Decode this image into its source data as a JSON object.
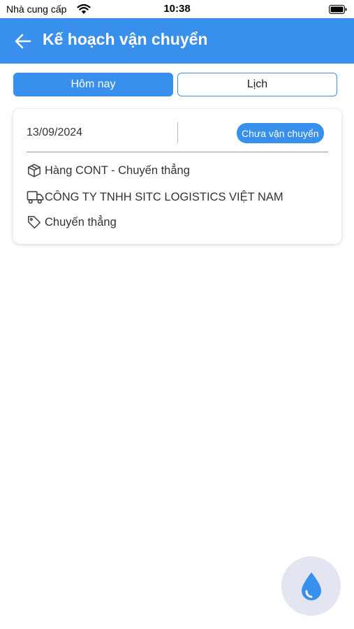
{
  "status_bar": {
    "carrier": "Nhà cung cấp",
    "time": "10:38"
  },
  "header": {
    "title": "Kế hoạch vận chuyển"
  },
  "tabs": [
    {
      "label": "Hôm nay",
      "active": true
    },
    {
      "label": "Lịch",
      "active": false
    }
  ],
  "shipment": {
    "date": "13/09/2024",
    "status": "Chưa vận chuyển",
    "cargo": "Hàng CONT - Chuyến thẳng",
    "company": "CÔNG TY TNHH SITC LOGISTICS VIỆT NAM",
    "tag": "Chuyến thẳng"
  },
  "colors": {
    "primary": "#3990ec",
    "fab_bg": "#e3e5f1"
  },
  "icons": [
    "wifi-icon",
    "battery-icon",
    "back-arrow-icon",
    "box-icon",
    "truck-icon",
    "tag-icon",
    "water-drop-icon"
  ]
}
